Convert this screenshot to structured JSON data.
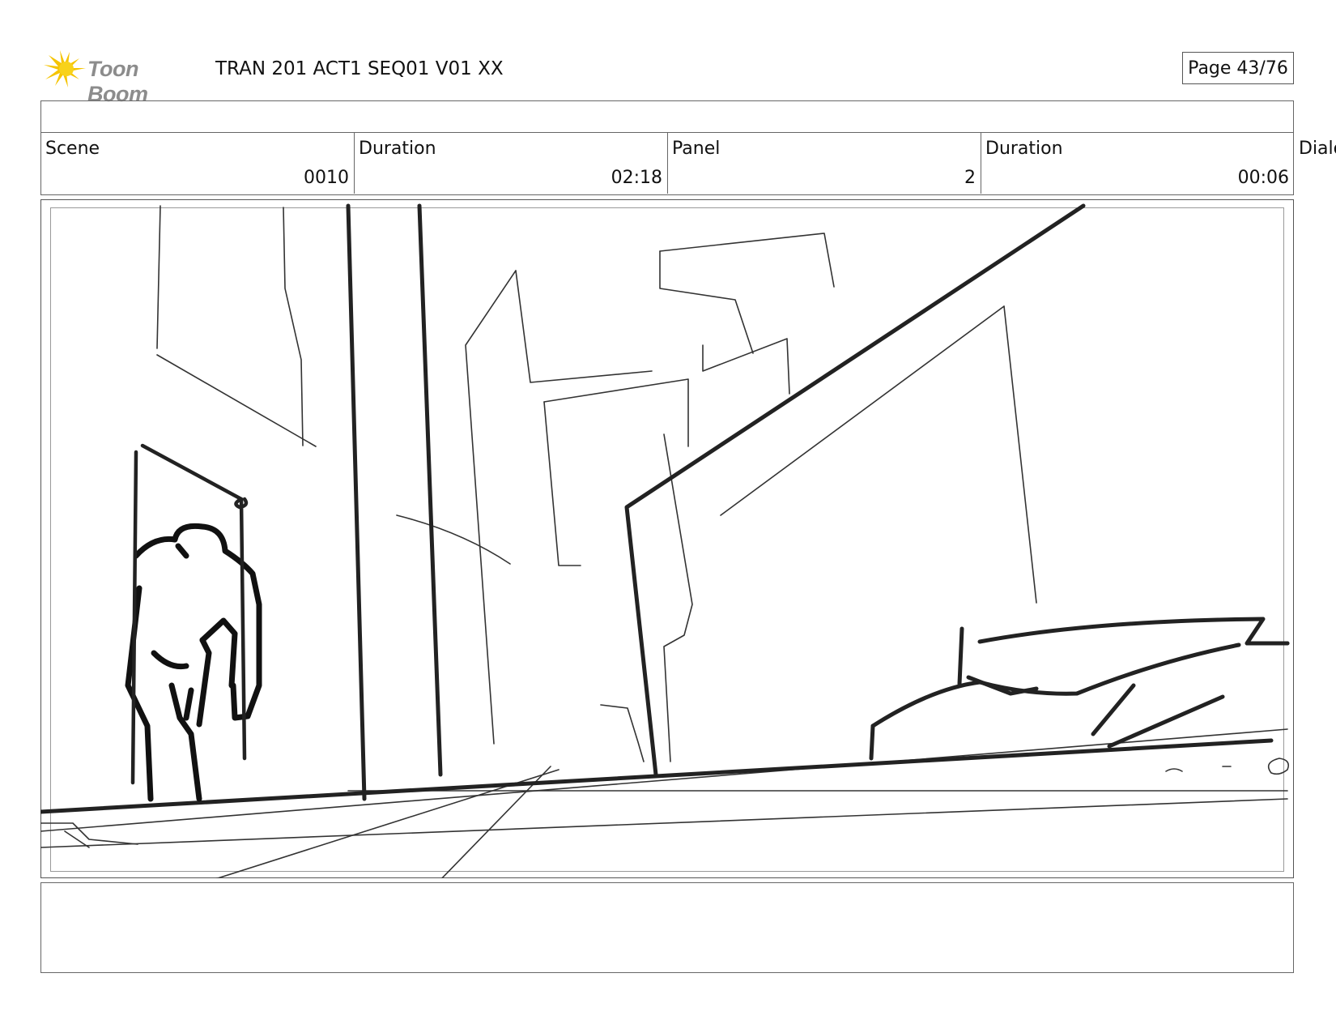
{
  "header": {
    "logo_text": "Toon Boom",
    "title": "TRAN 201 ACT1 SEQ01 V01 XX",
    "page": "Page 43/76"
  },
  "info": {
    "scene_label": "Scene",
    "scene_value": "0010",
    "scene_duration_label": "Duration",
    "scene_duration_value": "02:18",
    "panel_label": "Panel",
    "panel_value": "2",
    "panel_duration_label": "Duration",
    "panel_duration_value": "00:06",
    "dialog_label": "Dialo"
  },
  "colors": {
    "logo_yellow": "#f5c400",
    "logo_text": "#8c8c8c",
    "sketch_ink": "#1a1a1a"
  },
  "icons": {
    "logo_icon": "sunburst-comet-icon"
  }
}
